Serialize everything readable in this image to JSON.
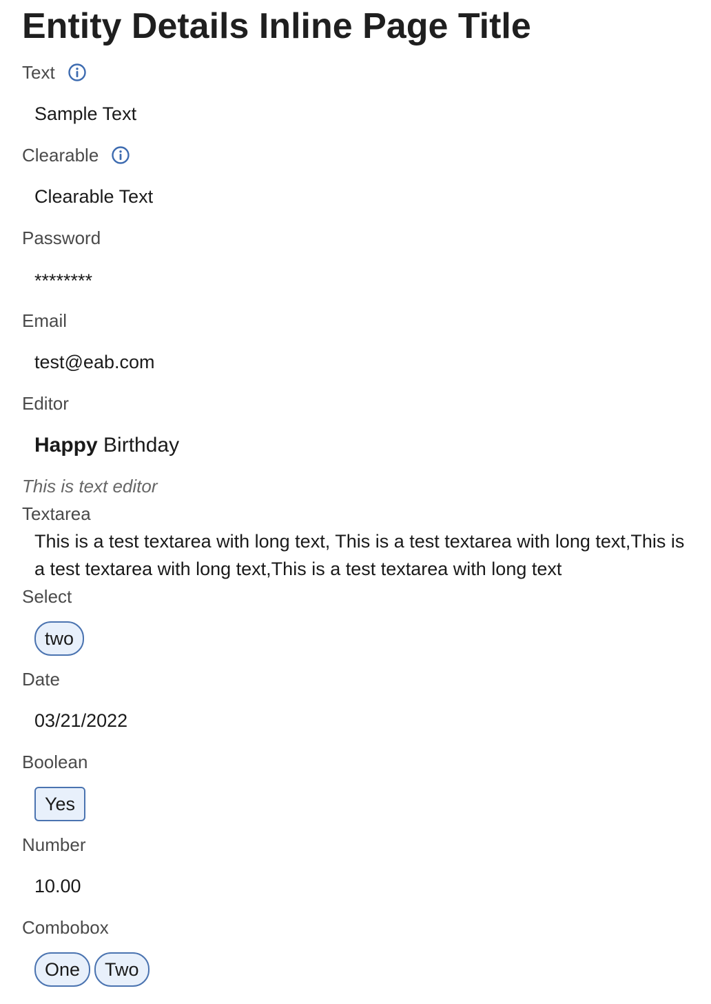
{
  "page": {
    "title": "Entity Details Inline Page Title"
  },
  "fields": {
    "text": {
      "label": "Text",
      "value": "Sample Text"
    },
    "clearable": {
      "label": "Clearable",
      "value": "Clearable Text"
    },
    "password": {
      "label": "Password",
      "value": "********"
    },
    "email": {
      "label": "Email",
      "value": "test@eab.com"
    },
    "editor": {
      "label": "Editor",
      "value_bold": "Happy",
      "value_rest": " Birthday",
      "hint": "This is text editor"
    },
    "textarea": {
      "label": "Textarea",
      "value": "This is a test textarea with long text, This is a test textarea with long text,This is a test textarea with long text,This is a test textarea with long text"
    },
    "select": {
      "label": "Select",
      "value": "two"
    },
    "date": {
      "label": "Date",
      "value": "03/21/2022"
    },
    "boolean": {
      "label": "Boolean",
      "value": "Yes"
    },
    "number": {
      "label": "Number",
      "value": "10.00"
    },
    "combobox": {
      "label": "Combobox",
      "values": [
        "One",
        "Two"
      ]
    }
  },
  "icons": {
    "info": "info-circle-icon"
  },
  "colors": {
    "accent": "#4a73b0",
    "chip_bg": "#e8f0fb"
  }
}
